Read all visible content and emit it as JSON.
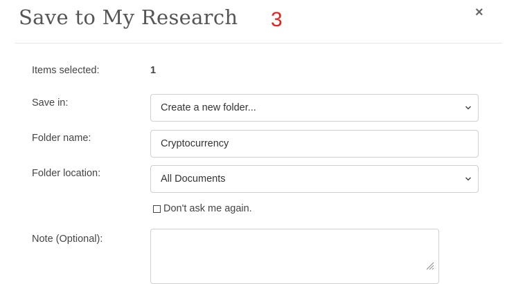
{
  "dialog": {
    "title": "Save to My Research",
    "step_number": "3",
    "close_glyph": "×"
  },
  "form": {
    "items_selected_label": "Items selected:",
    "items_selected_value": "1",
    "save_in_label": "Save in:",
    "save_in_value": "Create a new folder...",
    "folder_name_label": "Folder name:",
    "folder_name_value": "Cryptocurrency",
    "folder_location_label": "Folder location:",
    "folder_location_value": "All Documents",
    "dont_ask_label": "Don't ask me again.",
    "dont_ask_checked": false,
    "note_label": "Note (Optional):",
    "note_value": ""
  },
  "icons": {
    "close": "close-icon",
    "select_arrow": "chevron-down-icon",
    "resize": "resize-grip-icon"
  },
  "colors": {
    "step_number": "#e8211d",
    "border": "#cfcfcf",
    "text": "#444444"
  }
}
